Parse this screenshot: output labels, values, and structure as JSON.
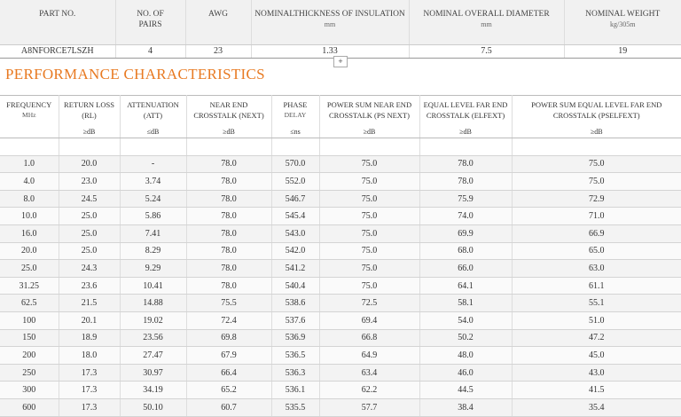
{
  "spec": {
    "headers": [
      {
        "label": "PART NO.",
        "unit": ""
      },
      {
        "label": "NO. OF",
        "unit": "PAIRS"
      },
      {
        "label": "AWG",
        "unit": ""
      },
      {
        "label": "NOMINALTHICKNESS OF INSULATION",
        "unit": "mm"
      },
      {
        "label": "NOMINAL OVERALL DIAMETER",
        "unit": "mm"
      },
      {
        "label": "NOMINAL WEIGHT",
        "unit": "kg/305m"
      }
    ],
    "row": [
      "A8NFORCE7LSZH",
      "4",
      "23",
      "1.33",
      "7.5",
      "19"
    ]
  },
  "expand_button": "+",
  "section_title": "PERFORMANCE CHARACTERISTICS",
  "performance": {
    "headers": [
      {
        "line1": "FREQUENCY",
        "line2": "MHz",
        "unit": ""
      },
      {
        "line1": "RETURN LOSS",
        "line2": "(RL)",
        "unit": "≥dB"
      },
      {
        "line1": "ATTENUATION",
        "line2": "(ATT)",
        "unit": "≤dB"
      },
      {
        "line1": "NEAR END",
        "line2": "CROSSTALK (NEXT)",
        "unit": "≥dB"
      },
      {
        "line1": "PHASE",
        "line2": "DELAY",
        "unit": "≤ns"
      },
      {
        "line1": "POWER SUM NEAR END",
        "line2": "CROSSTALK (PS NEXT)",
        "unit": "≥dB"
      },
      {
        "line1": "EQUAL LEVEL FAR END",
        "line2": "CROSSTALK (ELFEXT)",
        "unit": "≥dB"
      },
      {
        "line1": "POWER SUM EQUAL LEVEL FAR END",
        "line2": "CROSSTALK (PSELFEXT)",
        "unit": "≥dB"
      }
    ],
    "rows": [
      [
        "1.0",
        "20.0",
        "-",
        "78.0",
        "570.0",
        "75.0",
        "78.0",
        "75.0"
      ],
      [
        "4.0",
        "23.0",
        "3.74",
        "78.0",
        "552.0",
        "75.0",
        "78.0",
        "75.0"
      ],
      [
        "8.0",
        "24.5",
        "5.24",
        "78.0",
        "546.7",
        "75.0",
        "75.9",
        "72.9"
      ],
      [
        "10.0",
        "25.0",
        "5.86",
        "78.0",
        "545.4",
        "75.0",
        "74.0",
        "71.0"
      ],
      [
        "16.0",
        "25.0",
        "7.41",
        "78.0",
        "543.0",
        "75.0",
        "69.9",
        "66.9"
      ],
      [
        "20.0",
        "25.0",
        "8.29",
        "78.0",
        "542.0",
        "75.0",
        "68.0",
        "65.0"
      ],
      [
        "25.0",
        "24.3",
        "9.29",
        "78.0",
        "541.2",
        "75.0",
        "66.0",
        "63.0"
      ],
      [
        "31.25",
        "23.6",
        "10.41",
        "78.0",
        "540.4",
        "75.0",
        "64.1",
        "61.1"
      ],
      [
        "62.5",
        "21.5",
        "14.88",
        "75.5",
        "538.6",
        "72.5",
        "58.1",
        "55.1"
      ],
      [
        "100",
        "20.1",
        "19.02",
        "72.4",
        "537.6",
        "69.4",
        "54.0",
        "51.0"
      ],
      [
        "150",
        "18.9",
        "23.56",
        "69.8",
        "536.9",
        "66.8",
        "50.2",
        "47.2"
      ],
      [
        "200",
        "18.0",
        "27.47",
        "67.9",
        "536.5",
        "64.9",
        "48.0",
        "45.0"
      ],
      [
        "250",
        "17.3",
        "30.97",
        "66.4",
        "536.3",
        "63.4",
        "46.0",
        "43.0"
      ],
      [
        "300",
        "17.3",
        "34.19",
        "65.2",
        "536.1",
        "62.2",
        "44.5",
        "41.5"
      ],
      [
        "600",
        "17.3",
        "50.10",
        "60.7",
        "535.5",
        "57.7",
        "38.4",
        "35.4"
      ]
    ]
  }
}
